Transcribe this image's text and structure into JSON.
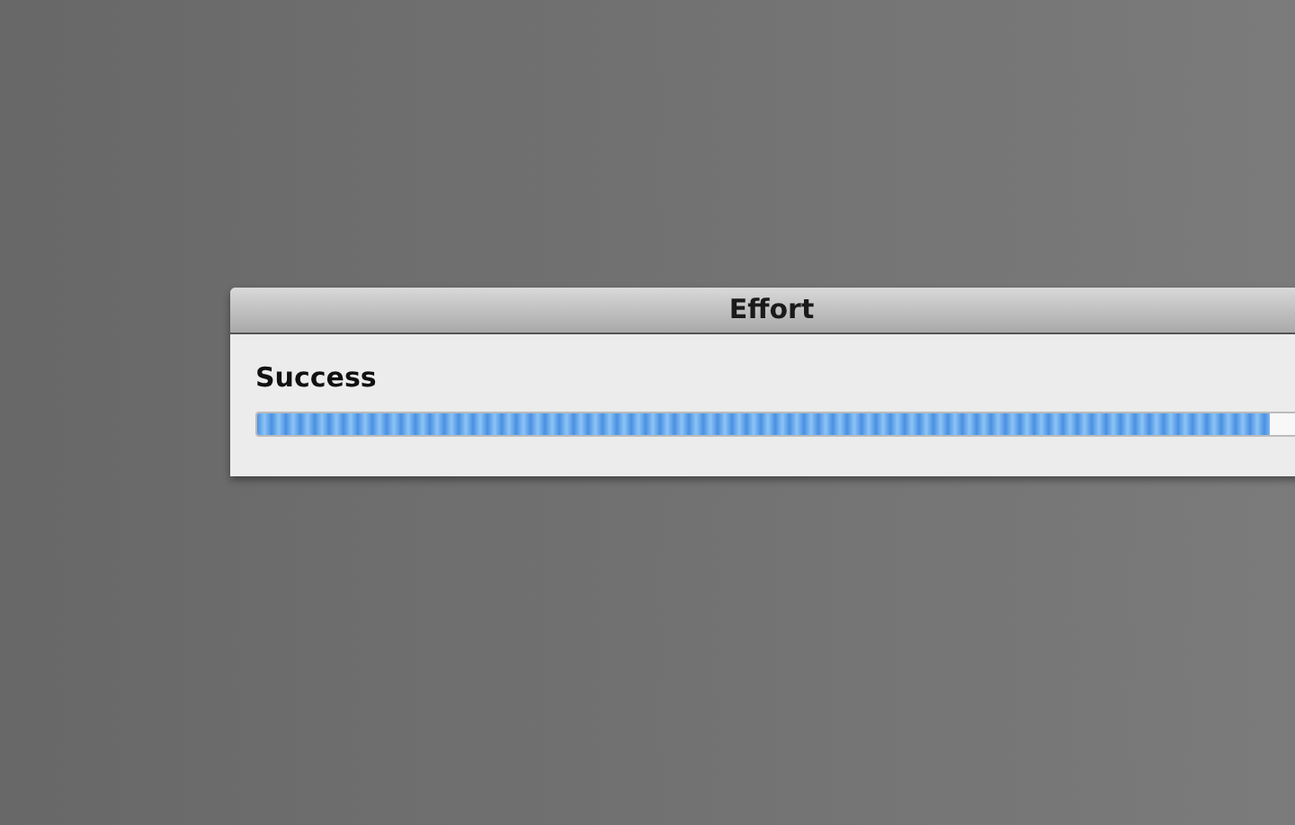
{
  "dialog": {
    "title": "Effort",
    "message": "Success",
    "progress": {
      "level": 0.97
    }
  }
}
